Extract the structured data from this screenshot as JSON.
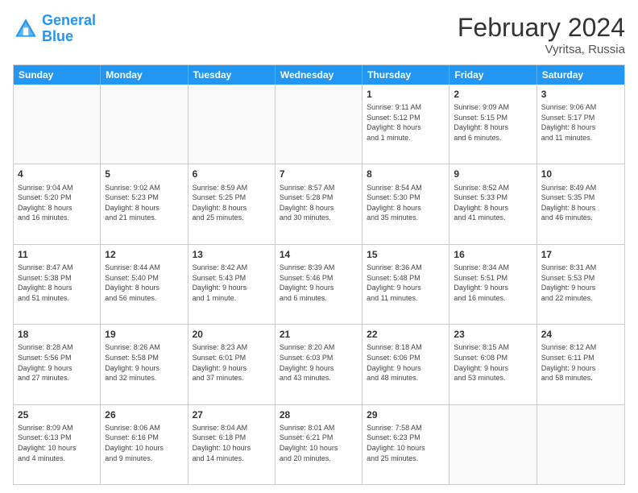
{
  "logo": {
    "line1": "General",
    "line2": "Blue"
  },
  "title": "February 2024",
  "subtitle": "Vyritsa, Russia",
  "days": [
    "Sunday",
    "Monday",
    "Tuesday",
    "Wednesday",
    "Thursday",
    "Friday",
    "Saturday"
  ],
  "rows": [
    [
      {
        "day": "",
        "info": ""
      },
      {
        "day": "",
        "info": ""
      },
      {
        "day": "",
        "info": ""
      },
      {
        "day": "",
        "info": ""
      },
      {
        "day": "1",
        "info": "Sunrise: 9:11 AM\nSunset: 5:12 PM\nDaylight: 8 hours\nand 1 minute."
      },
      {
        "day": "2",
        "info": "Sunrise: 9:09 AM\nSunset: 5:15 PM\nDaylight: 8 hours\nand 6 minutes."
      },
      {
        "day": "3",
        "info": "Sunrise: 9:06 AM\nSunset: 5:17 PM\nDaylight: 8 hours\nand 11 minutes."
      }
    ],
    [
      {
        "day": "4",
        "info": "Sunrise: 9:04 AM\nSunset: 5:20 PM\nDaylight: 8 hours\nand 16 minutes."
      },
      {
        "day": "5",
        "info": "Sunrise: 9:02 AM\nSunset: 5:23 PM\nDaylight: 8 hours\nand 21 minutes."
      },
      {
        "day": "6",
        "info": "Sunrise: 8:59 AM\nSunset: 5:25 PM\nDaylight: 8 hours\nand 25 minutes."
      },
      {
        "day": "7",
        "info": "Sunrise: 8:57 AM\nSunset: 5:28 PM\nDaylight: 8 hours\nand 30 minutes."
      },
      {
        "day": "8",
        "info": "Sunrise: 8:54 AM\nSunset: 5:30 PM\nDaylight: 8 hours\nand 35 minutes."
      },
      {
        "day": "9",
        "info": "Sunrise: 8:52 AM\nSunset: 5:33 PM\nDaylight: 8 hours\nand 41 minutes."
      },
      {
        "day": "10",
        "info": "Sunrise: 8:49 AM\nSunset: 5:35 PM\nDaylight: 8 hours\nand 46 minutes."
      }
    ],
    [
      {
        "day": "11",
        "info": "Sunrise: 8:47 AM\nSunset: 5:38 PM\nDaylight: 8 hours\nand 51 minutes."
      },
      {
        "day": "12",
        "info": "Sunrise: 8:44 AM\nSunset: 5:40 PM\nDaylight: 8 hours\nand 56 minutes."
      },
      {
        "day": "13",
        "info": "Sunrise: 8:42 AM\nSunset: 5:43 PM\nDaylight: 9 hours\nand 1 minute."
      },
      {
        "day": "14",
        "info": "Sunrise: 8:39 AM\nSunset: 5:46 PM\nDaylight: 9 hours\nand 6 minutes."
      },
      {
        "day": "15",
        "info": "Sunrise: 8:36 AM\nSunset: 5:48 PM\nDaylight: 9 hours\nand 11 minutes."
      },
      {
        "day": "16",
        "info": "Sunrise: 8:34 AM\nSunset: 5:51 PM\nDaylight: 9 hours\nand 16 minutes."
      },
      {
        "day": "17",
        "info": "Sunrise: 8:31 AM\nSunset: 5:53 PM\nDaylight: 9 hours\nand 22 minutes."
      }
    ],
    [
      {
        "day": "18",
        "info": "Sunrise: 8:28 AM\nSunset: 5:56 PM\nDaylight: 9 hours\nand 27 minutes."
      },
      {
        "day": "19",
        "info": "Sunrise: 8:26 AM\nSunset: 5:58 PM\nDaylight: 9 hours\nand 32 minutes."
      },
      {
        "day": "20",
        "info": "Sunrise: 8:23 AM\nSunset: 6:01 PM\nDaylight: 9 hours\nand 37 minutes."
      },
      {
        "day": "21",
        "info": "Sunrise: 8:20 AM\nSunset: 6:03 PM\nDaylight: 9 hours\nand 43 minutes."
      },
      {
        "day": "22",
        "info": "Sunrise: 8:18 AM\nSunset: 6:06 PM\nDaylight: 9 hours\nand 48 minutes."
      },
      {
        "day": "23",
        "info": "Sunrise: 8:15 AM\nSunset: 6:08 PM\nDaylight: 9 hours\nand 53 minutes."
      },
      {
        "day": "24",
        "info": "Sunrise: 8:12 AM\nSunset: 6:11 PM\nDaylight: 9 hours\nand 58 minutes."
      }
    ],
    [
      {
        "day": "25",
        "info": "Sunrise: 8:09 AM\nSunset: 6:13 PM\nDaylight: 10 hours\nand 4 minutes."
      },
      {
        "day": "26",
        "info": "Sunrise: 8:06 AM\nSunset: 6:16 PM\nDaylight: 10 hours\nand 9 minutes."
      },
      {
        "day": "27",
        "info": "Sunrise: 8:04 AM\nSunset: 6:18 PM\nDaylight: 10 hours\nand 14 minutes."
      },
      {
        "day": "28",
        "info": "Sunrise: 8:01 AM\nSunset: 6:21 PM\nDaylight: 10 hours\nand 20 minutes."
      },
      {
        "day": "29",
        "info": "Sunrise: 7:58 AM\nSunset: 6:23 PM\nDaylight: 10 hours\nand 25 minutes."
      },
      {
        "day": "",
        "info": ""
      },
      {
        "day": "",
        "info": ""
      }
    ]
  ]
}
